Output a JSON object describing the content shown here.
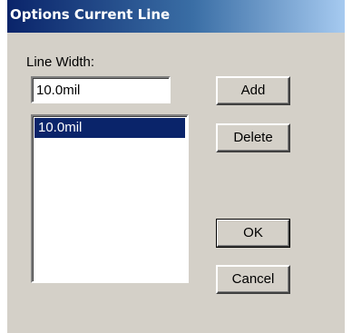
{
  "window": {
    "title": "Options Current Line"
  },
  "form": {
    "line_width_label": "Line Width:",
    "line_width_value": "10.0mil",
    "list_items": [
      {
        "label": "10.0mil",
        "selected": true
      }
    ]
  },
  "buttons": {
    "add_label": "Add",
    "delete_label": "Delete",
    "ok_label": "OK",
    "cancel_label": "Cancel"
  },
  "colors": {
    "title_bar_start": "#0a246a",
    "title_bar_end": "#a6caf0",
    "dialog_background": "#d4d0c8",
    "selection": "#0a246a"
  }
}
